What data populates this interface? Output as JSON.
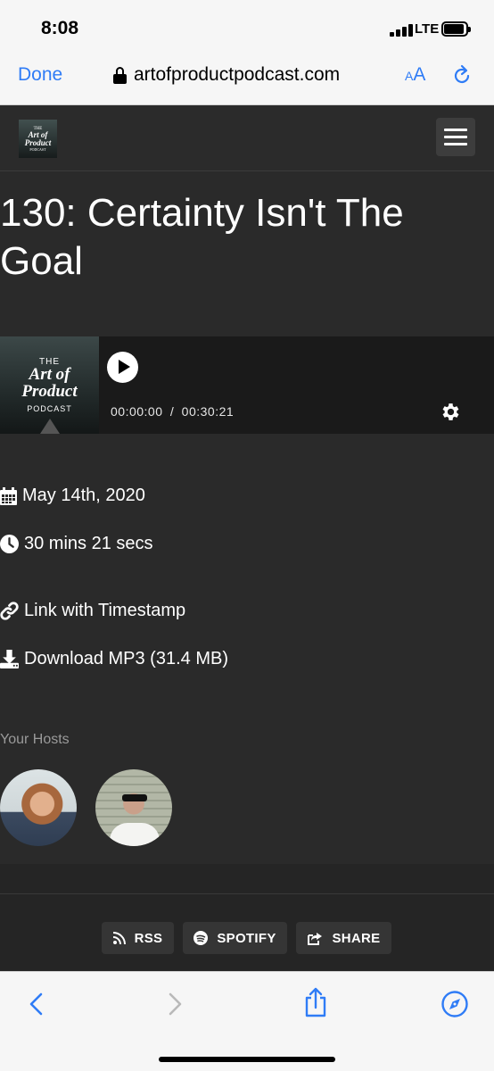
{
  "status_bar": {
    "time": "8:08",
    "network": "LTE",
    "battery_level": 0.85
  },
  "browser": {
    "done_label": "Done",
    "url": "artofproductpodcast.com",
    "text_size_label_small": "A",
    "text_size_label_large": "A"
  },
  "site": {
    "logo": {
      "line1": "THE",
      "line2": "Art of Product",
      "line3": "PODCAST"
    }
  },
  "episode": {
    "title": "130: Certainty Isn't The Goal",
    "cover": {
      "line1": "THE",
      "line2": "Art of",
      "line3": "Product",
      "line4": "PODCAST"
    },
    "player": {
      "current_time": "00:00:00",
      "separator": "/",
      "duration": "00:30:21"
    },
    "date": "May 14th, 2020",
    "length": "30 mins 21 secs",
    "link_label": "Link with Timestamp",
    "download_label": "Download MP3 (31.4 MB)"
  },
  "hosts": {
    "label": "Your Hosts"
  },
  "footer": {
    "rss_label": "RSS",
    "spotify_label": "SPOTIFY",
    "share_label": "SHARE"
  },
  "colors": {
    "accent": "#2f7cf6",
    "page_bg": "#2a2a2a",
    "player_bg": "#1a1a1a"
  },
  "icons": [
    "lock-icon",
    "reload-icon",
    "menu-icon",
    "play-icon",
    "gear-icon",
    "calendar-icon",
    "clock-icon",
    "link-icon",
    "download-icon",
    "rss-icon",
    "spotify-icon",
    "share-icon",
    "back-icon",
    "forward-icon",
    "share-sheet-icon",
    "compass-icon"
  ]
}
